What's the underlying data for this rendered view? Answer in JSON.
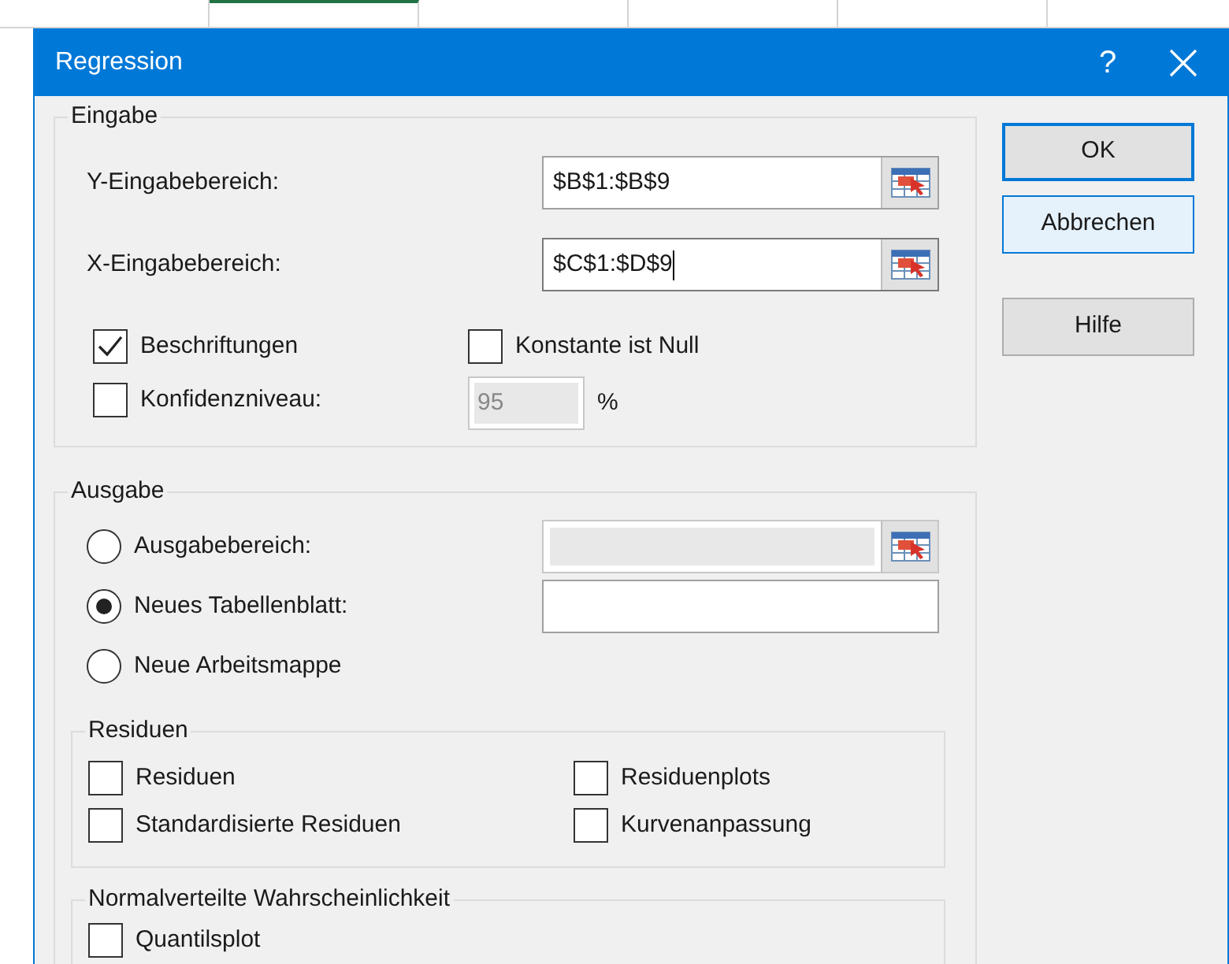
{
  "window": {
    "title": "Regression",
    "help_button": "?"
  },
  "input_group": {
    "title": "Eingabe",
    "fields": [
      {
        "label": "Y-Eingabebereich:",
        "value": "$B$1:$B$9",
        "focused": false
      },
      {
        "label": "X-Eingabebereich:",
        "value": "$C$1:$D$9",
        "focused": true
      }
    ],
    "options": [
      {
        "label": "Beschriftungen",
        "checked": true
      },
      {
        "label": "Konstante ist Null",
        "checked": false
      },
      {
        "label": "Konfidenzniveau:",
        "checked": false
      }
    ],
    "confidence": {
      "value": "95",
      "disabled": true,
      "unit": "%"
    }
  },
  "output_group": {
    "title": "Ausgabe",
    "destinations": [
      {
        "label": "Ausgabebereich:",
        "selected": false,
        "kind": "ref-field",
        "disabled": true
      },
      {
        "label": "Neues Tabellenblatt:",
        "selected": true,
        "kind": "field"
      },
      {
        "label": "Neue Arbeitsmappe",
        "selected": false,
        "kind": "none"
      }
    ],
    "residuals": {
      "title": "Residuen",
      "options": [
        {
          "label": "Residuen",
          "checked": false
        },
        {
          "label": "Residuenplots",
          "checked": false
        },
        {
          "label": "Standardisierte Residuen",
          "checked": false
        },
        {
          "label": "Kurvenanpassung",
          "checked": false
        }
      ]
    },
    "probability": {
      "title": "Normalverteilte Wahrscheinlichkeit",
      "options": [
        {
          "label": "Quantilsplot",
          "checked": false
        }
      ]
    }
  },
  "buttons": [
    {
      "label": "OK",
      "kind": "default"
    },
    {
      "label": "Abbrechen",
      "kind": "focused"
    },
    {
      "label": "Hilfe",
      "kind": "normal"
    }
  ]
}
